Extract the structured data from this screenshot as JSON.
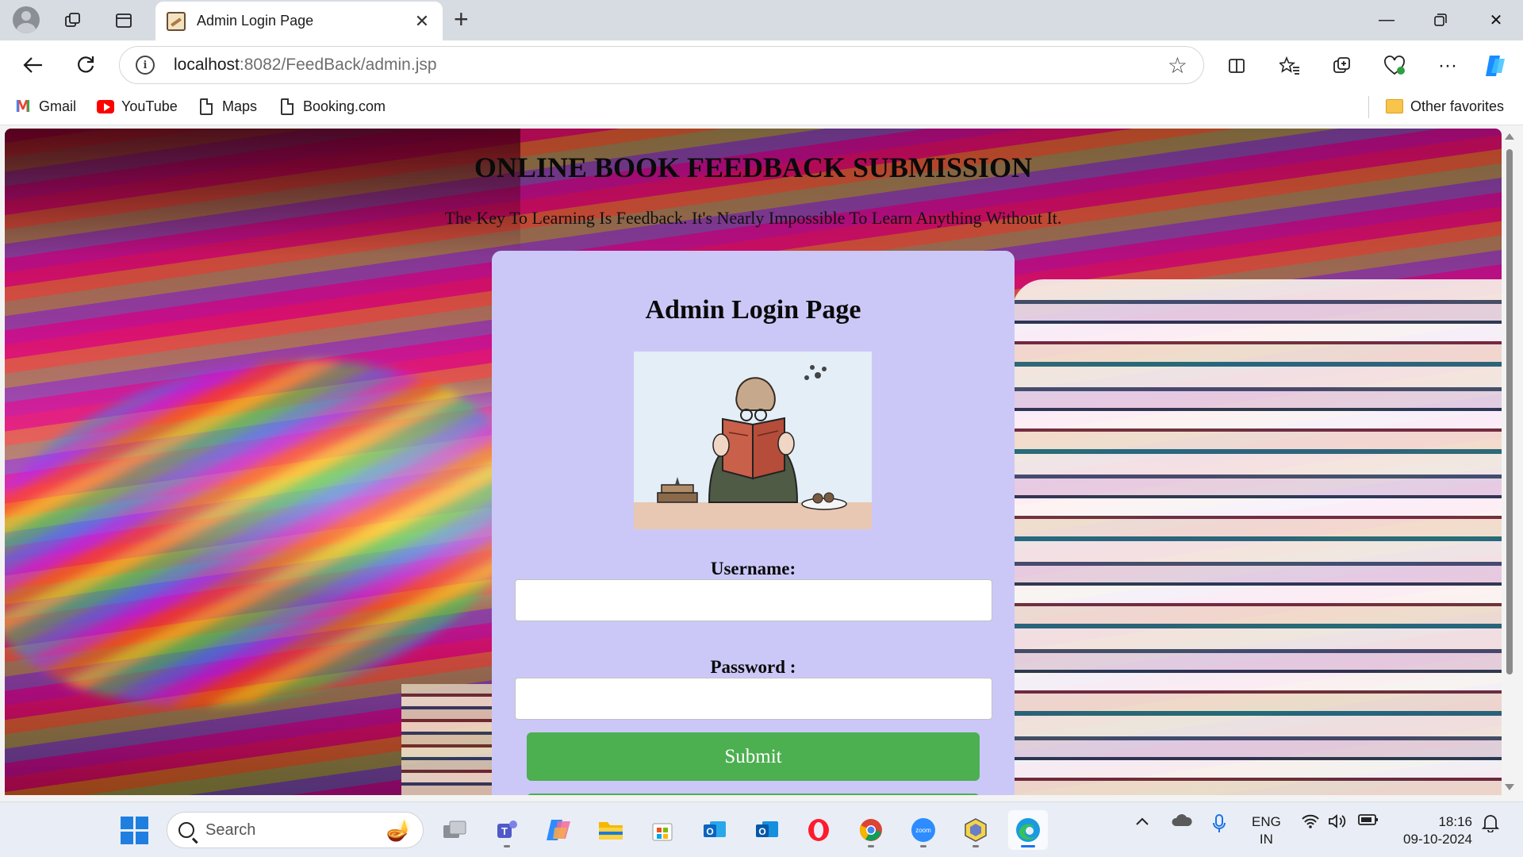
{
  "browser": {
    "tab_title": "Admin Login Page",
    "url_host": "localhost",
    "url_path": ":8082/FeedBack/admin.jsp",
    "new_tab_icon": "plus-icon",
    "bookmarks": [
      {
        "label": "Gmail",
        "icon": "gmail-icon"
      },
      {
        "label": "YouTube",
        "icon": "youtube-icon"
      },
      {
        "label": "Maps",
        "icon": "page-icon"
      },
      {
        "label": "Booking.com",
        "icon": "page-icon"
      }
    ],
    "other_favorites": "Other favorites"
  },
  "page": {
    "title": "ONLINE BOOK FEEDBACK SUBMISSION",
    "subtitle": "The Key To Learning Is Feedback. It's Nearly Impossible To Learn Anything Without It.",
    "login": {
      "heading": "Admin Login Page",
      "image_alt": "reader-illustration",
      "username_label": "Username:",
      "username_value": "",
      "password_label": "Password :",
      "password_value": "",
      "submit_label": "Submit"
    }
  },
  "taskbar": {
    "search_placeholder": "Search",
    "language_line1": "ENG",
    "language_line2": "IN",
    "time": "18:16",
    "date": "09-10-2024",
    "zoom_label": "zoom"
  },
  "colors": {
    "card_bg": "#cbc8f8",
    "submit_bg": "#4caf50",
    "accent": "#1a73e8"
  }
}
